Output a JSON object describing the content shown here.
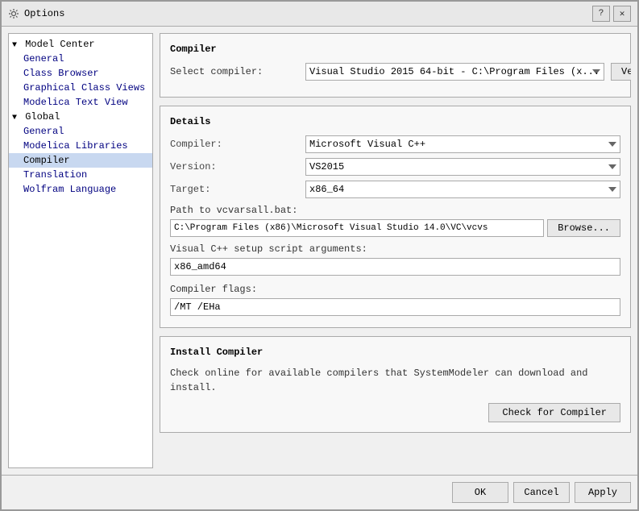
{
  "window": {
    "title": "Options",
    "help_btn": "?",
    "close_btn": "✕"
  },
  "sidebar": {
    "items": [
      {
        "id": "model-center",
        "label": "Model Center",
        "type": "group",
        "expanded": true
      },
      {
        "id": "general-mc",
        "label": "General",
        "type": "child"
      },
      {
        "id": "class-browser",
        "label": "Class Browser",
        "type": "child"
      },
      {
        "id": "graphical-class-views",
        "label": "Graphical Class Views",
        "type": "child"
      },
      {
        "id": "modelica-text-view",
        "label": "Modelica Text View",
        "type": "child"
      },
      {
        "id": "global",
        "label": "Global",
        "type": "group",
        "expanded": true
      },
      {
        "id": "general-global",
        "label": "General",
        "type": "child"
      },
      {
        "id": "modelica-libraries",
        "label": "Modelica Libraries",
        "type": "child"
      },
      {
        "id": "compiler",
        "label": "Compiler",
        "type": "child",
        "selected": true
      },
      {
        "id": "translation",
        "label": "Translation",
        "type": "child"
      },
      {
        "id": "wolfram-language",
        "label": "Wolfram Language",
        "type": "child"
      }
    ]
  },
  "compiler_section": {
    "title": "Compiler",
    "select_compiler_label": "Select compiler:",
    "select_compiler_value": "Visual Studio 2015 64-bit - C:\\Program Files (x...",
    "verify_btn": "Verify"
  },
  "details_section": {
    "title": "Details",
    "compiler_label": "Compiler:",
    "compiler_value": "Microsoft Visual C++",
    "version_label": "Version:",
    "version_value": "VS2015",
    "target_label": "Target:",
    "target_value": "x86_64",
    "path_label": "Path to vcvarsall.bat:",
    "path_value": "C:\\Program Files (x86)\\Microsoft Visual Studio 14.0\\VC\\vcvs",
    "browse_btn": "Browse...",
    "vcsetup_label": "Visual C++ setup script arguments:",
    "vcsetup_value": "x86_amd64",
    "flags_label": "Compiler flags:",
    "flags_value": "/MT /EHa"
  },
  "install_section": {
    "title": "Install Compiler",
    "description": "Check online for available compilers that SystemModeler can download and install.",
    "check_btn": "Check for Compiler"
  },
  "footer": {
    "ok_btn": "OK",
    "cancel_btn": "Cancel",
    "apply_btn": "Apply"
  }
}
